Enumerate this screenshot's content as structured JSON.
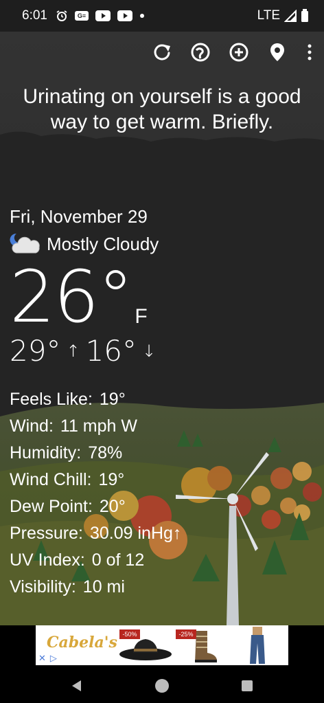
{
  "status_bar": {
    "time": "6:01",
    "network": "LTE"
  },
  "toolbar": {
    "icons": [
      "refresh-icon",
      "radar-icon",
      "add-icon",
      "location-icon",
      "more-icon"
    ]
  },
  "quote": "Urinating on yourself is a good way to get warm. Briefly.",
  "weather": {
    "date": "Fri, November 29",
    "condition": "Mostly Cloudy",
    "temperature": "26°",
    "unit": "F",
    "high": "29°",
    "low": "16°"
  },
  "details": [
    {
      "label": "Feels Like:",
      "value": "19°"
    },
    {
      "label": "Wind:",
      "value": "11 mph W"
    },
    {
      "label": "Humidity:",
      "value": "78%"
    },
    {
      "label": "Wind Chill:",
      "value": "19°"
    },
    {
      "label": "Dew Point:",
      "value": "20°"
    },
    {
      "label": "Pressure:",
      "value": "30.09 inHg↑"
    },
    {
      "label": "UV Index:",
      "value": "0 of 12"
    },
    {
      "label": "Visibility:",
      "value": "10 mi"
    }
  ],
  "ad": {
    "brand": "Cabela's",
    "badge_1": "-50%",
    "badge_2": "-25%"
  }
}
